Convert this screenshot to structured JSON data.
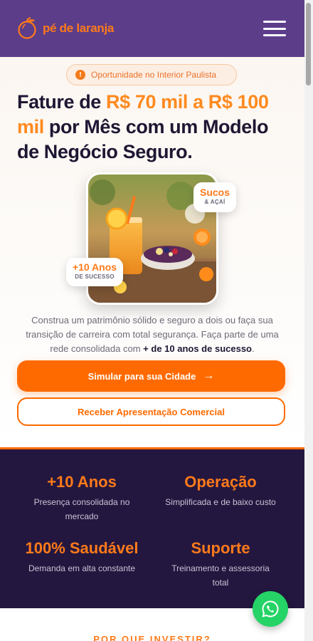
{
  "header": {
    "logo_text": "pé de laranja",
    "logo_icon": "orange-icon",
    "menu_icon": "hamburger-menu-icon"
  },
  "hero": {
    "badge": {
      "icon": "info-icon",
      "icon_glyph": "!",
      "text": "Oportunidade no Interior Paulista"
    },
    "headline": {
      "part1": "Fature de ",
      "highlight": "R$ 70 mil a R$ 100 mil",
      "part2": " por Mês com um Modelo de Negócio Seguro."
    },
    "chip_top": {
      "title": "Sucos",
      "subtitle": "& AÇAÍ"
    },
    "chip_bottom": {
      "title": "+10 Anos",
      "subtitle": "DE SUCESSO"
    },
    "description": {
      "text": "Construa um patrimônio sólido e seguro a dois ou faça sua transição de carreira com total segurança. Faça parte de uma rede consolidada com ",
      "bold": "+ de 10 anos de sucesso",
      "end": "."
    },
    "primary_button": {
      "label": "Simular para sua Cidade",
      "icon": "arrow-right-icon",
      "glyph": "→"
    },
    "secondary_button": {
      "label": "Receber Apresentação Comercial"
    }
  },
  "stats": [
    {
      "title": "+10 Anos",
      "desc": "Presença consolidada no mercado"
    },
    {
      "title": "Operação",
      "desc": "Simplificada e de baixo custo"
    },
    {
      "title": "100% Saudável",
      "desc": "Demanda em alta constante"
    },
    {
      "title": "Suporte",
      "desc": "Treinamento e assessoria total"
    }
  ],
  "next_section": {
    "title": "POR QUE INVESTIR?"
  },
  "whatsapp": {
    "icon": "whatsapp-icon"
  },
  "colors": {
    "brand_purple": "#5c3d8a",
    "brand_orange": "#ff6a00",
    "dark_navy": "#24173f",
    "whatsapp_green": "#25d366"
  }
}
